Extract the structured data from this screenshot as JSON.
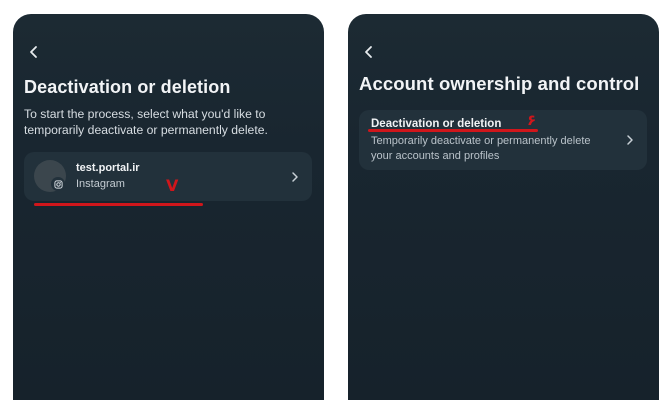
{
  "left_panel": {
    "title": "Deactivation or deletion",
    "description": "To start the process, select what you'd like to temporarily deactivate or permanently delete.",
    "account": {
      "name": "test.portal.ir",
      "platform": "Instagram"
    },
    "annotation": "V"
  },
  "right_panel": {
    "title": "Account ownership and control",
    "option": {
      "title": "Deactivation or deletion",
      "description": "Temporarily deactivate or permanently delete your accounts and profiles"
    },
    "annotation": "۶"
  },
  "colors": {
    "panel_bg": "#192630",
    "card_bg": "#22313b",
    "annotation_red": "#d0161b"
  },
  "icons": [
    "back-arrow-icon",
    "instagram-icon",
    "chevron-right-icon"
  ]
}
